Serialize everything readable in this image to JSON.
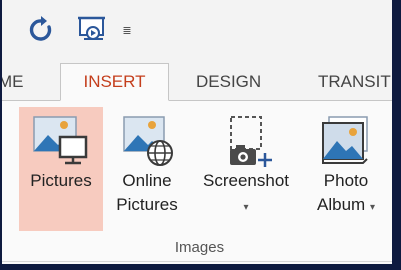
{
  "qat": {
    "items": [
      {
        "icon": "redo-icon"
      },
      {
        "icon": "present-from-start-icon"
      },
      {
        "icon": "customize-qat-arrow-icon",
        "glyph": "≣"
      }
    ]
  },
  "tabs": [
    {
      "label": "ME",
      "active": false
    },
    {
      "label": "INSERT",
      "active": true
    },
    {
      "label": "DESIGN",
      "active": false
    },
    {
      "label": "TRANSIT",
      "active": false
    }
  ],
  "ribbon": {
    "group_label": "Images",
    "buttons": [
      {
        "line1": "Pictures",
        "line2": "",
        "icon": "pictures-icon",
        "selected": true
      },
      {
        "line1": "Online",
        "line2": "Pictures",
        "icon": "online-pictures-icon",
        "selected": false
      },
      {
        "line1": "Screenshot",
        "line2": "",
        "dropdown": "▾",
        "icon": "screenshot-icon",
        "selected": false
      },
      {
        "line1": "Photo",
        "line2": "Album",
        "dropdown": "▾",
        "icon": "photo-album-icon",
        "selected": false
      }
    ]
  },
  "colors": {
    "accent": "#c43e1c",
    "selection": "#f7cbbf",
    "frame": "#0e1a3f",
    "ribbon_bg": "#fafafa"
  }
}
